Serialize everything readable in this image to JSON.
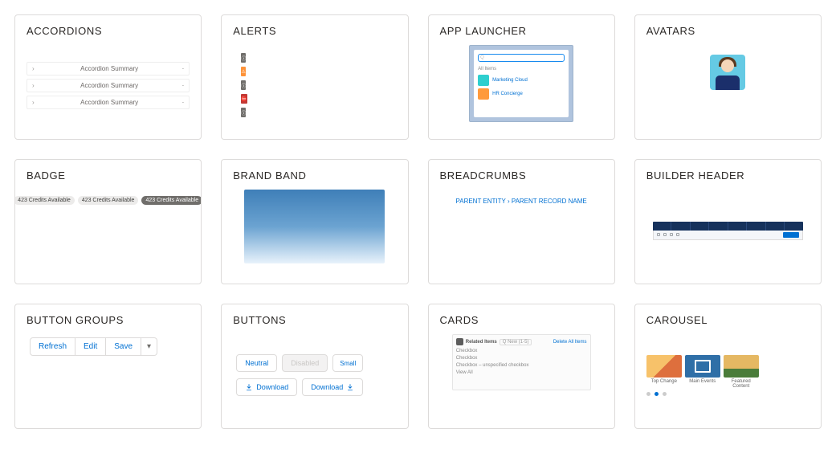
{
  "items": [
    {
      "title": "ACCORDIONS",
      "accordion": {
        "rows": [
          "Accordion Summary",
          "Accordion Summary",
          "Accordion Summary"
        ]
      }
    },
    {
      "title": "ALERTS",
      "alerts": {
        "bars": [
          "info",
          "warn",
          "info2",
          "err",
          "off"
        ]
      }
    },
    {
      "title": "APP LAUNCHER",
      "appLauncher": {
        "searchPlaceholder": "Q",
        "section": "All Items",
        "tiles": [
          {
            "name": "Marketing Cloud"
          },
          {
            "name": "HR Concierge"
          }
        ]
      }
    },
    {
      "title": "AVATARS"
    },
    {
      "title": "BADGE",
      "badges": {
        "b1": "423 Credits Available",
        "b2": "423 Credits Available",
        "b3": "423 Credits Available"
      }
    },
    {
      "title": "BRAND BAND"
    },
    {
      "title": "BREADCRUMBS",
      "crumbs": "PARENT ENTITY › PARENT RECORD NAME"
    },
    {
      "title": "BUILDER HEADER"
    },
    {
      "title": "BUTTON GROUPS",
      "buttonGroup": {
        "b1": "Refresh",
        "b2": "Edit",
        "b3": "Save",
        "b4": "▾"
      }
    },
    {
      "title": "BUTTONS",
      "buttons": {
        "neutral": "Neutral",
        "disabled": "Disabled",
        "small": "Small",
        "dl1": "Download",
        "dl2": "Download"
      }
    },
    {
      "title": "CARDS",
      "cardPreview": {
        "header": "Related Items",
        "count": "Q New (1-5)",
        "action": "Delete All Items",
        "r1": "Checkbox",
        "r2": "Checkbox",
        "r3": "Checkbox – unspecified checkbox",
        "r4": "View All"
      }
    },
    {
      "title": "CAROUSEL",
      "carousel": {
        "c1": "Top Change",
        "c2": "Main Events",
        "c3": "Featured Content"
      }
    }
  ]
}
